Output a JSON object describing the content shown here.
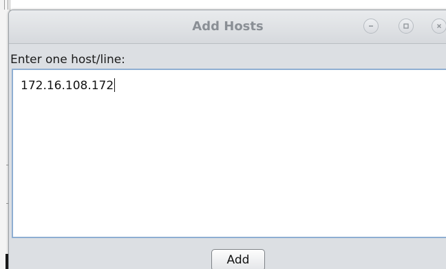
{
  "dialog": {
    "title": "Add Hosts",
    "window_controls": {
      "minimize_icon": "minimize-icon",
      "maximize_icon": "maximize-icon",
      "close_icon": "close-icon"
    },
    "prompt_label": "Enter one host/line:",
    "hosts_text": "172.16.108.172",
    "add_button_label": "Add"
  },
  "colors": {
    "dialog_background": "#dcdfe3",
    "title_text": "#8a8f95",
    "textarea_border_focus": "#8eaed2"
  }
}
